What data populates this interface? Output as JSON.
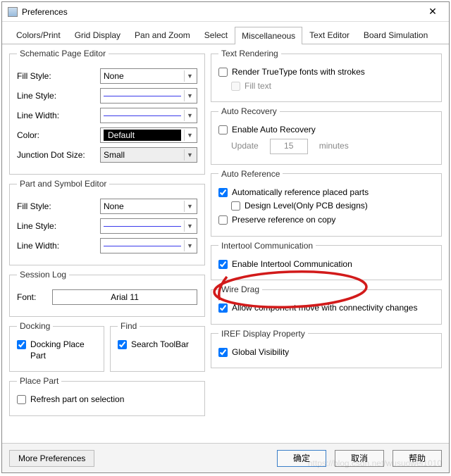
{
  "window": {
    "title": "Preferences"
  },
  "tabs": {
    "items": [
      {
        "label": "Colors/Print"
      },
      {
        "label": "Grid Display"
      },
      {
        "label": "Pan and Zoom"
      },
      {
        "label": "Select"
      },
      {
        "label": "Miscellaneous"
      },
      {
        "label": "Text Editor"
      },
      {
        "label": "Board Simulation"
      }
    ],
    "active_index": 4
  },
  "schematic_editor": {
    "legend": "Schematic Page Editor",
    "fill_style_label": "Fill Style:",
    "fill_style_value": "None",
    "line_style_label": "Line Style:",
    "line_width_label": "Line Width:",
    "color_label": "Color:",
    "color_value": "Default",
    "junction_label": "Junction Dot Size:",
    "junction_value": "Small"
  },
  "part_editor": {
    "legend": "Part and Symbol Editor",
    "fill_style_label": "Fill Style:",
    "fill_style_value": "None",
    "line_style_label": "Line Style:",
    "line_width_label": "Line Width:"
  },
  "session_log": {
    "legend": "Session Log",
    "font_label": "Font:",
    "font_value": "Arial 11"
  },
  "docking": {
    "legend": "Docking",
    "option_label": "Docking Place Part",
    "option_checked": true
  },
  "find": {
    "legend": "Find",
    "option_label": "Search ToolBar",
    "option_checked": true
  },
  "place_part": {
    "legend": "Place Part",
    "option_label": "Refresh part on selection",
    "option_checked": false
  },
  "text_rendering": {
    "legend": "Text Rendering",
    "opt1_label": "Render TrueType fonts with strokes",
    "opt1_checked": false,
    "opt2_label": "Fill text",
    "opt2_checked": false
  },
  "auto_recovery": {
    "legend": "Auto Recovery",
    "opt_label": "Enable Auto Recovery",
    "opt_checked": false,
    "update_label": "Update",
    "interval_value": "15",
    "unit_label": "minutes"
  },
  "auto_reference": {
    "legend": "Auto Reference",
    "opt1_label": "Automatically reference placed parts",
    "opt1_checked": true,
    "opt2_label": "Design Level(Only PCB designs)",
    "opt2_checked": false,
    "opt3_label": "Preserve reference on copy",
    "opt3_checked": false
  },
  "intertool": {
    "legend": "Intertool Communication",
    "opt_label": "Enable Intertool Communication",
    "opt_checked": true
  },
  "wire_drag": {
    "legend": "Wire Drag",
    "opt_label": "Allow component move with connectivity changes",
    "opt_checked": true
  },
  "iref": {
    "legend": "IREF Display Property",
    "opt_label": "Global Visibility",
    "opt_checked": true
  },
  "footer": {
    "more_label": "More Preferences",
    "ok_label": "确定",
    "cancel_label": "取消",
    "help_label": "帮助"
  },
  "watermark": "https://blog.csdn.net/wusuowei1010",
  "annotation_color": "#d21a1a"
}
